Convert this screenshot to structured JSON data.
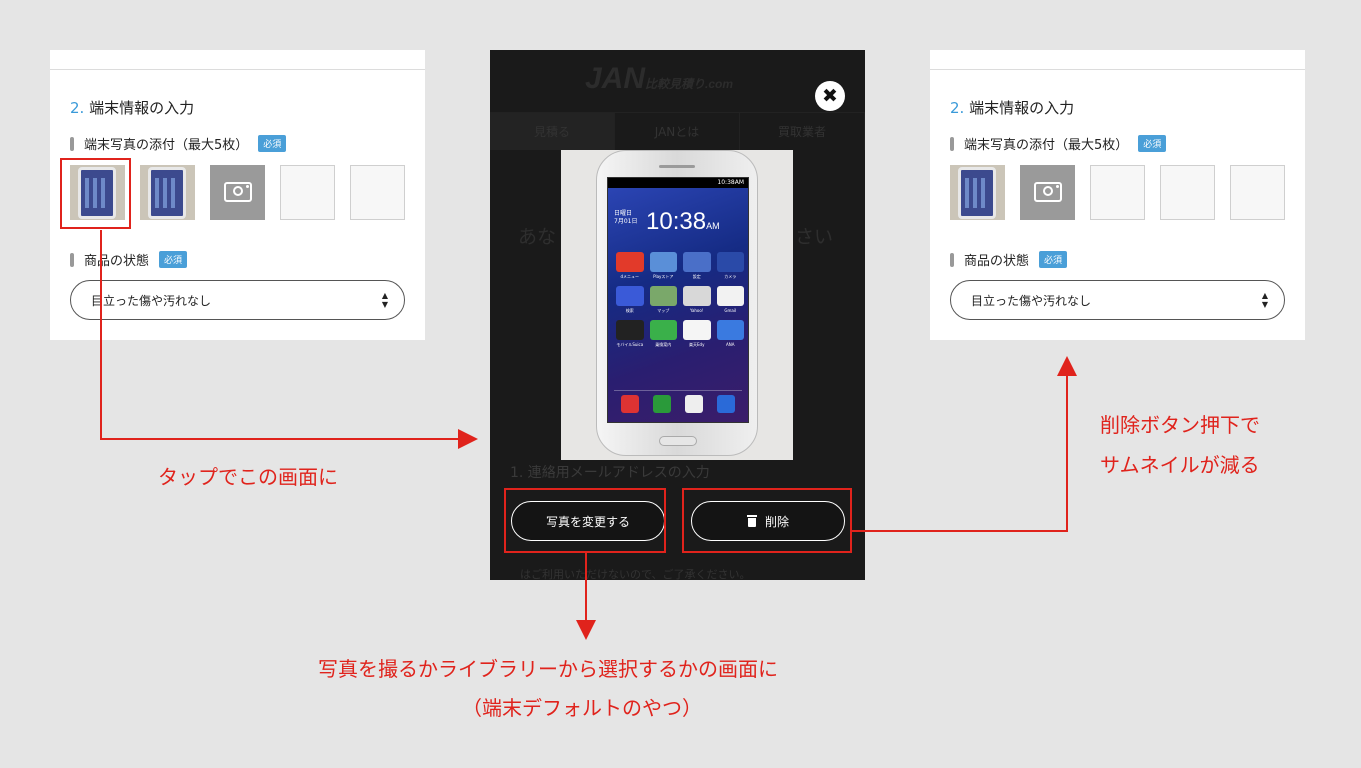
{
  "form": {
    "section_number": "2.",
    "section_title": "端末情報の入力",
    "photo_label": "端末写真の添付（最大5枚）",
    "required_badge": "必須",
    "condition_label": "商品の状態",
    "condition_value": "目立った傷や汚れなし",
    "select_arrows": "▲▼",
    "before_thumbnails": [
      "photo",
      "photo",
      "camera",
      "empty",
      "empty"
    ],
    "after_thumbnails": [
      "photo",
      "camera",
      "empty",
      "empty",
      "empty"
    ]
  },
  "modal": {
    "background_logo": "JAN",
    "background_logo_sub": "比較見積り.com",
    "background_tabs": [
      "見積る",
      "JANとは",
      "買取業者"
    ],
    "background_text_left": "あな",
    "background_text_right": "さい",
    "background_section": "1. 連絡用メールアドレスの入力",
    "background_footer": "はご利用いただけないので、ご了承ください。",
    "close_icon": "✖",
    "phone_screen": {
      "status": "10:38AM",
      "clock": "10:38",
      "clock_suffix": "AM",
      "date_line1": "日曜日",
      "date_line2": "7月01日",
      "apps": [
        "dメニュー",
        "Playストア",
        "設定",
        "カメラ",
        "検索",
        "マップ",
        "Yahoo!",
        "Gmail",
        "モバイルSuica",
        "乗換案内",
        "楽天Edy",
        "ANA",
        "",
        "",
        "",
        ""
      ]
    },
    "change_button": "写真を変更する",
    "delete_button": "削除"
  },
  "annotations": {
    "tap_note": "タップでこの画面に",
    "delete_note_line1": "削除ボタン押下で",
    "delete_note_line2": "サムネイルが減る",
    "change_note_line1": "写真を撮るかライブラリーから選択するかの画面に",
    "change_note_line2": "（端末デフォルトのやつ）",
    "accent_color": "#e0231c"
  }
}
